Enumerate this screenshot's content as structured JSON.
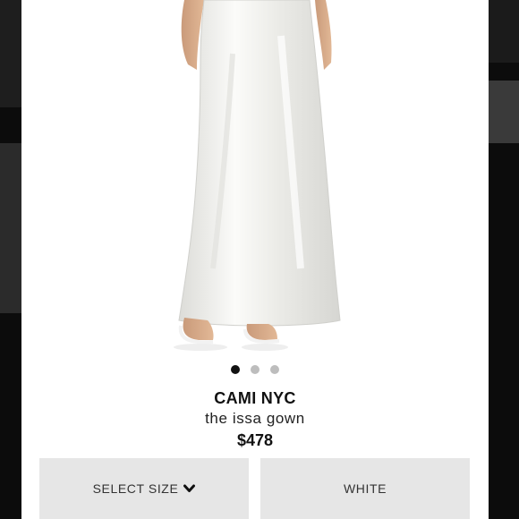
{
  "product": {
    "brand": "CAMI NYC",
    "name": "the issa gown",
    "price": "$478",
    "image": "white satin maxi gown with white strappy sandals"
  },
  "carousel": {
    "total": 3,
    "active_index": 0
  },
  "options": {
    "size_label": "SELECT SIZE",
    "color_label": "WHITE"
  },
  "colors": {
    "button_bg": "#e6e6e6",
    "dot_active": "#111111",
    "dot_inactive": "#bdbdbd"
  }
}
